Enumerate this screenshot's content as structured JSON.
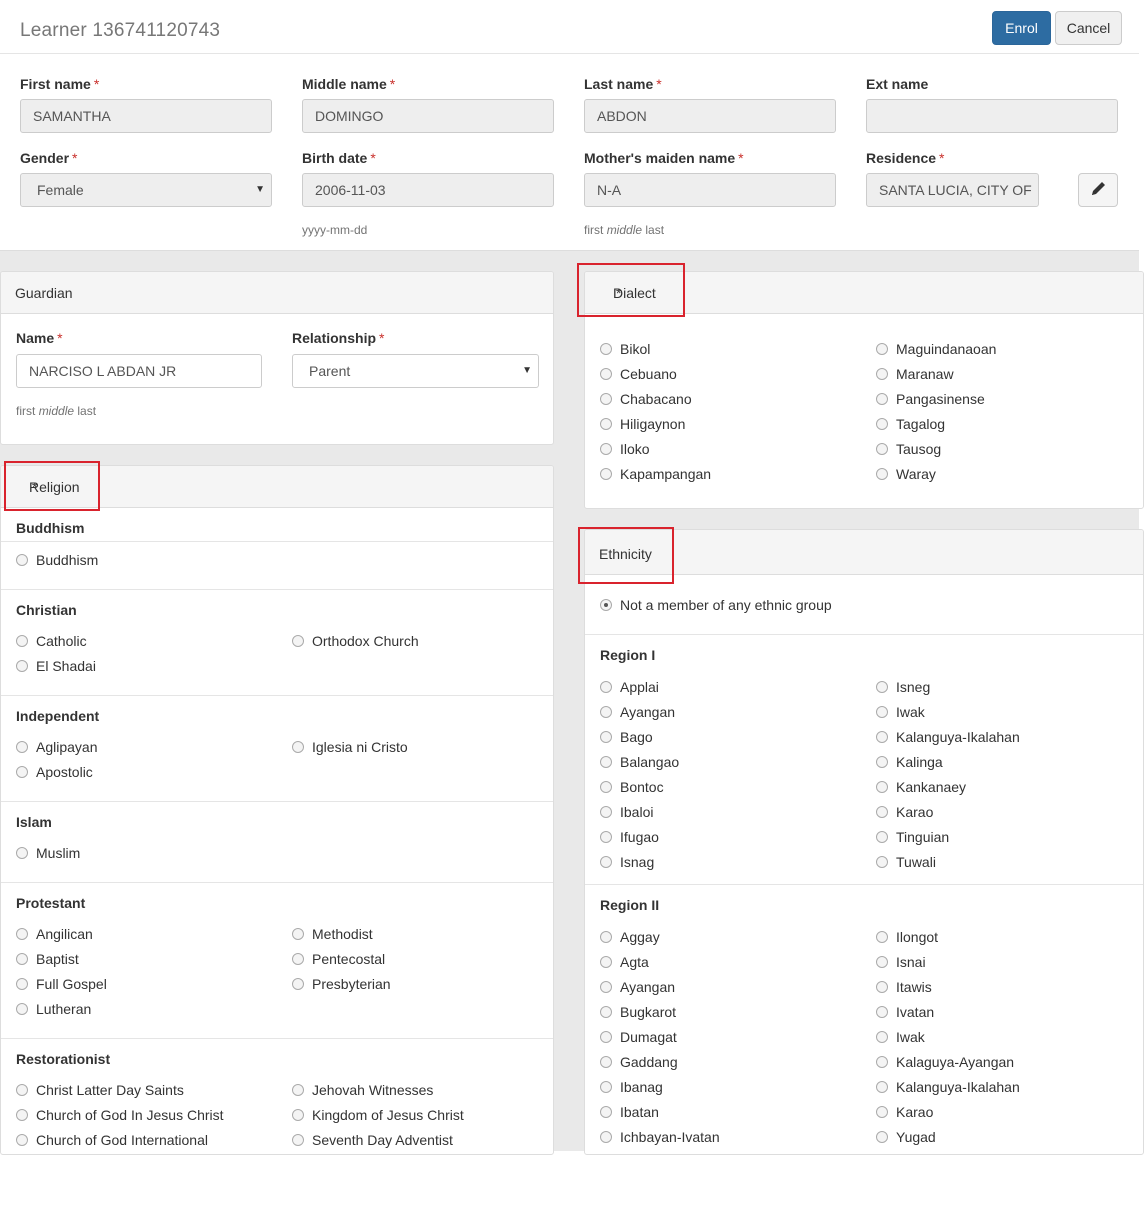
{
  "header": {
    "title": "Learner 136741120743",
    "enrol": "Enrol",
    "cancel": "Cancel"
  },
  "form": {
    "first_name": {
      "label": "First name",
      "value": "SAMANTHA"
    },
    "middle_name": {
      "label": "Middle name",
      "value": "DOMINGO"
    },
    "last_name": {
      "label": "Last name",
      "value": "ABDON"
    },
    "ext_name": {
      "label": "Ext name",
      "value": ""
    },
    "gender": {
      "label": "Gender",
      "value": "Female"
    },
    "birth_date": {
      "label": "Birth date",
      "value": "2006-11-03",
      "help": "yyyy-mm-dd"
    },
    "mother": {
      "label": "Mother's maiden name",
      "value": "N-A",
      "help_a": "first",
      "help_b": "middle",
      "help_c": "last"
    },
    "residence": {
      "label": "Residence",
      "value": "SANTA LUCIA, CITY OF"
    },
    "required_mark": "*"
  },
  "guardian": {
    "title": "Guardian",
    "name_label": "Name",
    "name_value": "NARCISO L  ABDAN JR",
    "relationship_label": "Relationship",
    "relationship_value": "Parent",
    "help_a": "first",
    "help_b": "middle",
    "help_c": "last"
  },
  "religion": {
    "title": "Religion",
    "groups": [
      {
        "name": "Buddhism",
        "left": [
          "Buddhism"
        ],
        "right": []
      },
      {
        "name": "Christian",
        "left": [
          "Catholic",
          "El Shadai"
        ],
        "right": [
          "Orthodox Church"
        ]
      },
      {
        "name": "Independent",
        "left": [
          "Aglipayan",
          "Apostolic"
        ],
        "right": [
          "Iglesia ni Cristo"
        ]
      },
      {
        "name": "Islam",
        "left": [
          "Muslim"
        ],
        "right": []
      },
      {
        "name": "Protestant",
        "left": [
          "Angilican",
          "Baptist",
          "Full Gospel",
          "Lutheran"
        ],
        "right": [
          "Methodist",
          "Pentecostal",
          "Presbyterian"
        ]
      },
      {
        "name": "Restorationist",
        "left": [
          "Christ Latter Day Saints",
          "Church of God In Jesus Christ",
          "Church of God International"
        ],
        "right": [
          "Jehovah Witnesses",
          "Kingdom of Jesus Christ",
          "Seventh Day Adventist"
        ]
      }
    ]
  },
  "dialect": {
    "title": "Dialect",
    "left": [
      "Bikol",
      "Cebuano",
      "Chabacano",
      "Hiligaynon",
      "Iloko",
      "Kapampangan"
    ],
    "right": [
      "Maguindanaoan",
      "Maranaw",
      "Pangasinense",
      "Tagalog",
      "Tausog",
      "Waray"
    ]
  },
  "ethnicity": {
    "title": "Ethnicity",
    "none_option": "Not a member of any ethnic group",
    "regions": [
      {
        "name": "Region I",
        "left": [
          "Applai",
          "Ayangan",
          "Bago",
          "Balangao",
          "Bontoc",
          "Ibaloi",
          "Ifugao",
          "Isnag"
        ],
        "right": [
          "Isneg",
          "Iwak",
          "Kalanguya-Ikalahan",
          "Kalinga",
          "Kankanaey",
          "Karao",
          "Tinguian",
          "Tuwali"
        ]
      },
      {
        "name": "Region II",
        "left": [
          "Aggay",
          "Agta",
          "Ayangan",
          "Bugkarot",
          "Dumagat",
          "Gaddang",
          "Ibanag",
          "Ibatan",
          "Ichbayan-Ivatan"
        ],
        "right": [
          "Ilongot",
          "Isnai",
          "Itawis",
          "Ivatan",
          "Iwak",
          "Kalaguya-Ayangan",
          "Kalanguya-Ikalahan",
          "Karao",
          "Yugad"
        ]
      }
    ]
  }
}
